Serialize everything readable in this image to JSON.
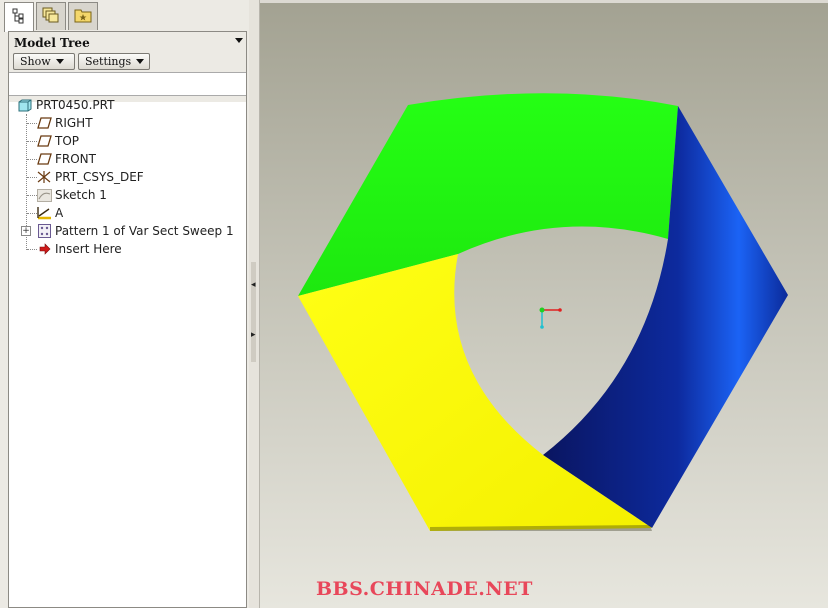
{
  "tabs": [
    {
      "icon": "model-tree-icon"
    },
    {
      "icon": "layer-tree-icon"
    },
    {
      "icon": "folder-browser-icon"
    }
  ],
  "panel": {
    "title": "Model Tree",
    "show_label": "Show",
    "settings_label": "Settings"
  },
  "tree": {
    "root": "PRT0450.PRT",
    "items": [
      {
        "label": "RIGHT",
        "icon": "datum-plane-icon"
      },
      {
        "label": "TOP",
        "icon": "datum-plane-icon"
      },
      {
        "label": "FRONT",
        "icon": "datum-plane-icon"
      },
      {
        "label": "PRT_CSYS_DEF",
        "icon": "coordinate-system-icon"
      },
      {
        "label": "Sketch 1",
        "icon": "sketch-icon"
      },
      {
        "label": "A",
        "icon": "datum-axis-icon"
      },
      {
        "label": "Pattern 1 of Var Sect Sweep 1",
        "icon": "pattern-icon"
      },
      {
        "label": "Insert Here",
        "icon": "insert-arrow-icon"
      }
    ]
  },
  "colors": {
    "green_face": "#22ff11",
    "blue_face": "#0f2a9a",
    "yellow_face": "#ffff00",
    "watermark": "#e8475a"
  },
  "watermark": "BBS.CHINADE.NET"
}
